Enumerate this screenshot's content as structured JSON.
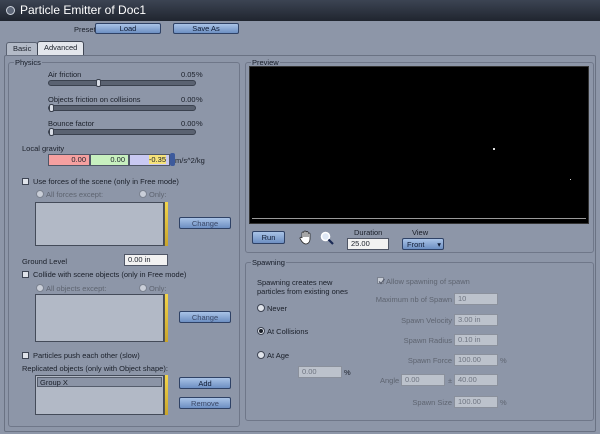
{
  "window": {
    "title": "Particle Emitter of Doc1"
  },
  "preset": {
    "label": "Preset:",
    "load": "Load",
    "save_as": "Save As"
  },
  "tabs": {
    "basic": "Basic",
    "advanced": "Advanced"
  },
  "physics": {
    "title": "Physics",
    "air_friction": {
      "label": "Air friction",
      "value": "0.05",
      "unit": "%",
      "level": 0.05
    },
    "objects_friction": {
      "label": "Objects friction on collisions",
      "value": "0.00",
      "unit": "%",
      "level": 0.0
    },
    "bounce": {
      "label": "Bounce factor",
      "value": "0.00",
      "unit": "%",
      "level": 0.0
    },
    "gravity": {
      "label": "Local gravity",
      "x": "0.00",
      "y": "0.00",
      "z": "-0.35",
      "unit": "m/s^2/kg",
      "colors": {
        "x": "#f5a0a0",
        "y": "#c8f0bf",
        "z": "#c9c9f2"
      }
    },
    "use_forces": {
      "label": "Use forces of the scene (only in Free mode)",
      "checked": false
    },
    "all_forces_except": "All forces except:",
    "only1": "Only:",
    "change1": "Change",
    "ground_level": {
      "label": "Ground Level",
      "value": "0.00 in"
    },
    "collide": {
      "label": "Collide with scene objects (only in Free mode)",
      "checked": false
    },
    "all_objects_except": "All objects except:",
    "only2": "Only:",
    "change2": "Change",
    "push": {
      "label": "Particles push each other (slow)",
      "checked": false
    },
    "replicated": {
      "label": "Replicated objects (only with Object shape):",
      "items": [
        "Group X"
      ]
    },
    "add": "Add",
    "remove": "Remove"
  },
  "preview": {
    "title": "Preview",
    "run": "Run",
    "duration_label": "Duration",
    "duration": "25.00",
    "view_label": "View",
    "view": "Front",
    "hand_icon": "hand-icon",
    "zoom_icon": "zoom-icon"
  },
  "spawning": {
    "title": "Spawning",
    "description": "Spawning creates new particles from existing ones",
    "allow": {
      "label": "Allow spawning of spawn",
      "checked": true
    },
    "options": [
      "Never",
      "At Collisions",
      "At Age"
    ],
    "selected": "At Collisions",
    "age_value": "0.00",
    "age_unit": "%",
    "max_spawn": {
      "label": "Maximum nb of Spawn",
      "value": "10"
    },
    "velocity": {
      "label": "Spawn Velocity",
      "value": "3.00 in"
    },
    "radius": {
      "label": "Spawn Radius",
      "value": "0.10 in"
    },
    "force": {
      "label": "Spawn Force",
      "value": "100.00",
      "unit": "%"
    },
    "angle": {
      "label": "Angle",
      "value_min": "0.00",
      "sep": "±",
      "value_max": "40.00"
    },
    "size": {
      "label": "Spawn Size",
      "value": "100.00",
      "unit": "%"
    }
  }
}
